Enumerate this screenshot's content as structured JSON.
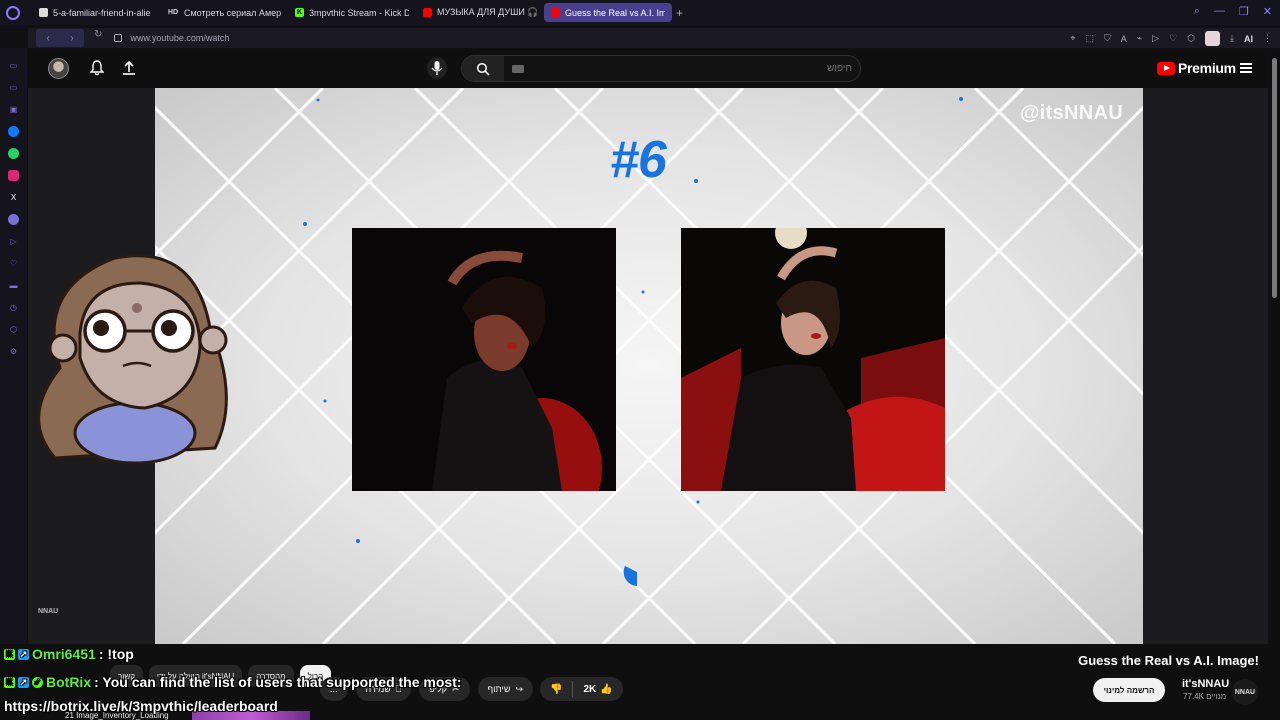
{
  "browser": {
    "tabs": [
      {
        "label": "5-a-familiar-friend-in-alie",
        "icon": "document-icon",
        "icon_color": "#ffffff",
        "active": false
      },
      {
        "label": "Смотреть сериал Амери",
        "icon": "hd-icon",
        "icon_color": "#ffffff",
        "active": false
      },
      {
        "label": "3mpvthic Stream - Kick D",
        "icon": "kick-icon",
        "icon_color": "#53fc18",
        "active": false
      },
      {
        "label": "МУЗЫКА ДЛЯ ДУШИ 🎧",
        "icon": "youtube-icon",
        "icon_color": "#ff0000",
        "active": false
      },
      {
        "label": "Guess the Real vs A.I. Imag",
        "icon": "youtube-icon",
        "icon_color": "#ff0000",
        "active": true
      }
    ],
    "new_tab_label": "+",
    "url": "www.youtube.com/watch",
    "hd_badge": "HD",
    "ai_label": "AI"
  },
  "youtube": {
    "search_placeholder": "חיפוש",
    "premium_label": "Premium",
    "video": {
      "watermark": "@itsNNAU",
      "round_label": "#6",
      "corner_logo": "NNAU"
    },
    "title": "Guess the Real vs A.I. Image!",
    "channel": {
      "name": "it'sNNAU",
      "avatar_text": "NNAU",
      "subscribers": "77.4K מנויים"
    },
    "subscribe_label": "הרשמה למינוי",
    "likes": "2K",
    "actions": {
      "share": "שיתוף",
      "clip": "קליפ",
      "save": "שמירה",
      "more": "..."
    },
    "chips": [
      "הכול",
      "מהסדרה",
      "הועלה על ידי it'sNNAU"
    ],
    "related_label": "קשור",
    "inventory_text": "21 Image_Inventory_Loading"
  },
  "stream_chat": [
    {
      "user": "Omri6451",
      "message": ": !top",
      "user_color": "#5cf03a"
    },
    {
      "user": "BotRix",
      "message": ": You can find the list of users that supported the most:",
      "user_color": "#5cf03a"
    }
  ],
  "chat_link": "https://botrix.live/k/3mpvthic/leaderboard",
  "colors": {
    "accent": "#1a74e0",
    "opera": "#8a7cff",
    "kick": "#53fc18"
  }
}
